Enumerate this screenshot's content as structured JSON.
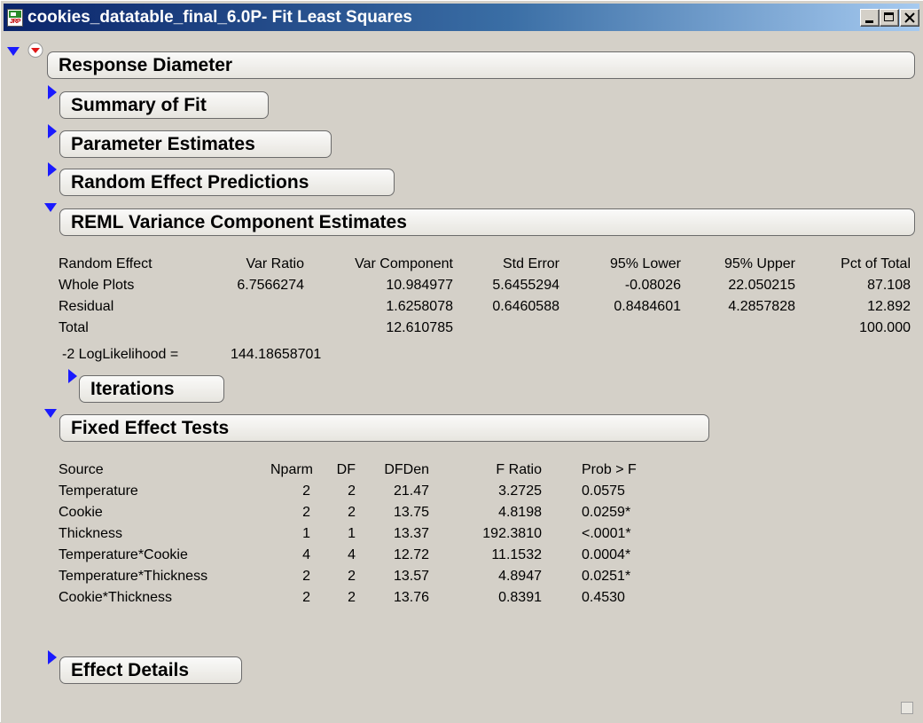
{
  "window": {
    "title": "cookies_datatable_final_6.0P- Fit Least Squares",
    "app_icon_text": "JRP"
  },
  "icons": {
    "expanded": "triangle-down-icon",
    "collapsed": "triangle-right-icon",
    "menu": "red-triangle-menu-icon",
    "colors": {
      "triangle": "#1a1aff",
      "menu_triangle": "#e01818"
    }
  },
  "response": {
    "title": "Response Diameter"
  },
  "sections": {
    "summary_of_fit": "Summary of Fit",
    "parameter_estimates": "Parameter Estimates",
    "random_effect_predictions": "Random Effect Predictions",
    "reml": "REML Variance Component Estimates",
    "iterations": "Iterations",
    "fixed_effect_tests": "Fixed Effect Tests",
    "effect_details": "Effect Details"
  },
  "reml_table": {
    "headers": [
      "Random Effect",
      "Var Ratio",
      "Var Component",
      "Std Error",
      "95% Lower",
      "95% Upper",
      "Pct of Total"
    ],
    "rows": [
      [
        "Whole Plots",
        "6.7566274",
        "10.984977",
        "5.6455294",
        "-0.08026",
        "22.050215",
        "87.108"
      ],
      [
        "Residual",
        "",
        "1.6258078",
        "0.6460588",
        "0.8484601",
        "4.2857828",
        "12.892"
      ],
      [
        "Total",
        "",
        "12.610785",
        "",
        "",
        "",
        "100.000"
      ]
    ],
    "loglik_label": "-2 LogLikelihood =",
    "loglik_value": "144.18658701"
  },
  "fixed_table": {
    "headers": [
      "Source",
      "Nparm",
      "DF",
      "DFDen",
      "F Ratio",
      "Prob > F"
    ],
    "rows": [
      [
        "Temperature",
        "2",
        "2",
        "21.47",
        "3.2725",
        "0.0575"
      ],
      [
        "Cookie",
        "2",
        "2",
        "13.75",
        "4.8198",
        "0.0259*"
      ],
      [
        "Thickness",
        "1",
        "1",
        "13.37",
        "192.3810",
        "<.0001*"
      ],
      [
        "Temperature*Cookie",
        "4",
        "4",
        "12.72",
        "11.1532",
        "0.0004*"
      ],
      [
        "Temperature*Thickness",
        "2",
        "2",
        "13.57",
        "4.8947",
        "0.0251*"
      ],
      [
        "Cookie*Thickness",
        "2",
        "2",
        "13.76",
        "0.8391",
        "0.4530"
      ]
    ]
  }
}
